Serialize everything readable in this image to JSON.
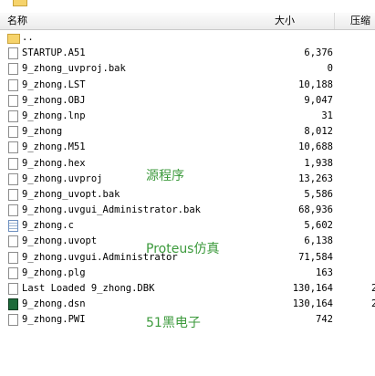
{
  "header": {
    "name": "名称",
    "size": "大小",
    "compressed": "压缩"
  },
  "files": [
    {
      "name": "..",
      "size": "",
      "comp": "",
      "icon": "folder-icon"
    },
    {
      "name": "STARTUP.A51",
      "size": "6,376",
      "comp": "",
      "icon": "file-icon"
    },
    {
      "name": "9_zhong_uvproj.bak",
      "size": "0",
      "comp": "",
      "icon": "file-icon"
    },
    {
      "name": "9_zhong.LST",
      "size": "10,188",
      "comp": "",
      "icon": "file-icon"
    },
    {
      "name": "9_zhong.OBJ",
      "size": "9,047",
      "comp": "",
      "icon": "file-icon"
    },
    {
      "name": "9_zhong.lnp",
      "size": "31",
      "comp": "",
      "icon": "file-icon"
    },
    {
      "name": "9_zhong",
      "size": "8,012",
      "comp": "",
      "icon": "file-icon"
    },
    {
      "name": "9_zhong.M51",
      "size": "10,688",
      "comp": "",
      "icon": "file-icon"
    },
    {
      "name": "9_zhong.hex",
      "size": "1,938",
      "comp": "",
      "icon": "file-icon"
    },
    {
      "name": "9_zhong.uvproj",
      "size": "13,263",
      "comp": "",
      "icon": "file-icon"
    },
    {
      "name": "9_zhong_uvopt.bak",
      "size": "5,586",
      "comp": "",
      "icon": "file-icon"
    },
    {
      "name": "9_zhong.uvgui_Administrator.bak",
      "size": "68,936",
      "comp": "",
      "icon": "file-icon"
    },
    {
      "name": "9_zhong.c",
      "size": "5,602",
      "comp": "",
      "icon": "text-file-icon"
    },
    {
      "name": "9_zhong.uvopt",
      "size": "6,138",
      "comp": "",
      "icon": "file-icon"
    },
    {
      "name": "9_zhong.uvgui.Administrator",
      "size": "71,584",
      "comp": "",
      "icon": "file-icon"
    },
    {
      "name": "9_zhong.plg",
      "size": "163",
      "comp": "",
      "icon": "file-icon"
    },
    {
      "name": "Last Loaded 9_zhong.DBK",
      "size": "130,164",
      "comp": "2",
      "icon": "file-icon"
    },
    {
      "name": "9_zhong.dsn",
      "size": "130,164",
      "comp": "2",
      "icon": "proteus-file-icon"
    },
    {
      "name": "9_zhong.PWI",
      "size": "742",
      "comp": "",
      "icon": "file-icon"
    }
  ],
  "annotations": {
    "source": "源程序",
    "proteus": "Proteus仿真",
    "mcu": "51黑电子"
  }
}
